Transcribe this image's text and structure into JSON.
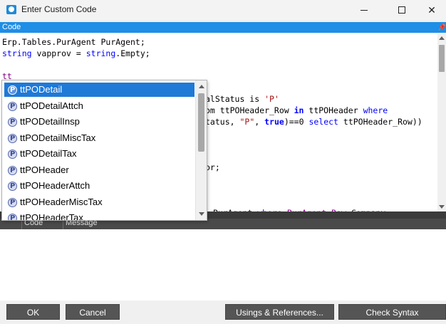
{
  "window": {
    "title": "Enter Custom Code",
    "controls": {
      "close": "✕"
    }
  },
  "editor": {
    "header_label": "Code",
    "header_pin": "📌"
  },
  "code_lines": [
    [
      {
        "t": "Erp.Tables.PurAgent PurAgent;",
        "c": ""
      }
    ],
    [
      {
        "t": "string",
        "c": "kw"
      },
      {
        "t": " vapprov = ",
        "c": ""
      },
      {
        "t": "string",
        "c": "kw"
      },
      {
        "t": ".Empty;",
        "c": ""
      }
    ],
    [],
    [
      {
        "t": "tt",
        "c": "var"
      }
    ],
    [],
    [
      {
        "t": "alStatus is ",
        "c": ""
      },
      {
        "t": "'P'",
        "c": "str"
      }
    ],
    [
      {
        "t": "om ttPOHeader_Row ",
        "c": ""
      },
      {
        "t": "in",
        "c": "kw-bold"
      },
      {
        "t": " ttPOHeader ",
        "c": ""
      },
      {
        "t": "where",
        "c": "kw"
      }
    ],
    [
      {
        "t": "tatus, ",
        "c": ""
      },
      {
        "t": "\"P\"",
        "c": "str"
      },
      {
        "t": ", ",
        "c": ""
      },
      {
        "t": "true",
        "c": "kw-bold"
      },
      {
        "t": ")==0 ",
        "c": ""
      },
      {
        "t": "select",
        "c": "kw"
      },
      {
        "t": " ttPOHeader_Row))",
        "c": ""
      }
    ],
    [],
    [],
    [],
    [
      {
        "t": "or;",
        "c": ""
      }
    ],
    [],
    [],
    [],
    [
      {
        "t": " PurAgent ",
        "c": ""
      },
      {
        "t": "where",
        "c": "kw"
      },
      {
        "t": " PurAgent_Row",
        "c": "var"
      },
      {
        "t": ".Company ==",
        "c": ""
      }
    ]
  ],
  "autocomplete": {
    "items": [
      {
        "label": "ttPODetail",
        "selected": true
      },
      {
        "label": "ttPODetailAttch",
        "selected": false
      },
      {
        "label": "ttPODetailInsp",
        "selected": false
      },
      {
        "label": "ttPODetailMiscTax",
        "selected": false
      },
      {
        "label": "ttPODetailTax",
        "selected": false
      },
      {
        "label": "ttPOHeader",
        "selected": false
      },
      {
        "label": "ttPOHeaderAttch",
        "selected": false
      },
      {
        "label": "ttPOHeaderMiscTax",
        "selected": false
      },
      {
        "label": "ttPOHeaderTax",
        "selected": false
      }
    ]
  },
  "messages": {
    "columns": [
      "Code",
      "Message"
    ]
  },
  "footer": {
    "ok": "OK",
    "cancel": "Cancel",
    "usings": "Usings & References...",
    "check_syntax": "Check Syntax"
  }
}
